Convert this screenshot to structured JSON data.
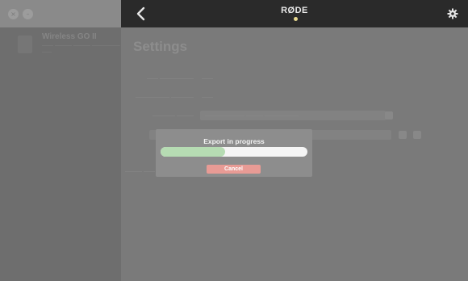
{
  "window": {
    "close_glyph": "×",
    "minimize_glyph": "–"
  },
  "sidebar": {
    "device": {
      "name": "Wireless GO II",
      "subtitle": "—— ——— ——— —————",
      "detail": "——"
    }
  },
  "header": {
    "brand": "RØDE",
    "accent_color": "#e9d98f"
  },
  "content": {
    "page_title": "Settings",
    "rows": [
      {
        "label": "—— ——————",
        "value": "——"
      },
      {
        "label": "—————— ————",
        "value": "——"
      },
      {
        "label": "———— ———",
        "value": "——————— ——— ——————"
      }
    ],
    "footer_note": "——— ——"
  },
  "modal": {
    "title": "Export in progress",
    "progress": 0.44,
    "progress_color": "#b6dcb3",
    "cancel_label": "Cancel",
    "cancel_color": "#e89b95"
  }
}
